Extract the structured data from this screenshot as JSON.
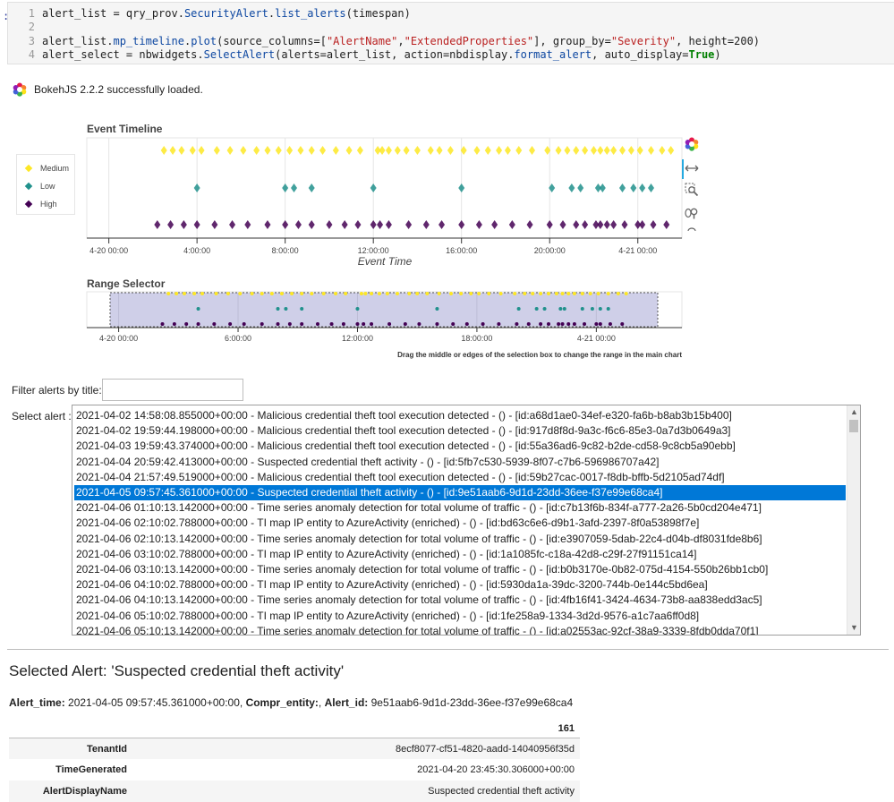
{
  "code_cell": {
    "prompt": ":",
    "lines": [
      {
        "num": "1",
        "segments": [
          {
            "t": "alert_list = qry_prov.",
            "c": "v"
          },
          {
            "t": "SecurityAlert",
            "c": "a"
          },
          {
            "t": ".",
            "c": "v"
          },
          {
            "t": "list_alerts",
            "c": "a"
          },
          {
            "t": "(timespan)",
            "c": "v"
          }
        ]
      },
      {
        "num": "2",
        "segments": []
      },
      {
        "num": "3",
        "segments": [
          {
            "t": "alert_list.",
            "c": "v"
          },
          {
            "t": "mp_timeline",
            "c": "a"
          },
          {
            "t": ".",
            "c": "v"
          },
          {
            "t": "plot",
            "c": "a"
          },
          {
            "t": "(source_columns=[",
            "c": "v"
          },
          {
            "t": "\"AlertName\"",
            "c": "s"
          },
          {
            "t": ",",
            "c": "v"
          },
          {
            "t": "\"ExtendedProperties\"",
            "c": "s"
          },
          {
            "t": "], group_by=",
            "c": "v"
          },
          {
            "t": "\"Severity\"",
            "c": "s"
          },
          {
            "t": ", height=200)",
            "c": "v"
          }
        ]
      },
      {
        "num": "4",
        "segments": [
          {
            "t": "alert_select = nbwidgets.",
            "c": "v"
          },
          {
            "t": "SelectAlert",
            "c": "a"
          },
          {
            "t": "(alerts=alert_list, action=nbdisplay.",
            "c": "v"
          },
          {
            "t": "format_alert",
            "c": "a"
          },
          {
            "t": ", auto_display=",
            "c": "v"
          },
          {
            "t": "True",
            "c": "k"
          },
          {
            "t": ")",
            "c": "v"
          }
        ]
      }
    ]
  },
  "bokeh": {
    "loaded_message": "BokehJS 2.2.2 successfully loaded."
  },
  "timeline": {
    "title": "Event Timeline",
    "xlabel": "Event Time",
    "x_ticks": [
      "4-20 00:00",
      "4:00:00",
      "8:00:00",
      "12:00:00",
      "16:00:00",
      "20:00:00",
      "4-21 00:00"
    ],
    "legend": [
      {
        "label": "Medium",
        "color": "#fde725"
      },
      {
        "label": "Low",
        "color": "#21918c"
      },
      {
        "label": "High",
        "color": "#440154"
      }
    ],
    "toolbar_icons": [
      "bokeh-logo-icon",
      "pan-icon",
      "box-zoom-icon",
      "wheel-zoom-icon",
      "reset-icon"
    ]
  },
  "range_selector": {
    "title": "Range Selector",
    "x_ticks": [
      "4-20 00:00",
      "6:00:00",
      "12:00:00",
      "18:00:00",
      "4-21 00:00"
    ],
    "note": "Drag the middle or edges of the selection box to change the range in the main chart"
  },
  "chart_data": {
    "type": "scatter",
    "title": "Event Timeline",
    "xlabel": "Event Time",
    "x_unit": "hours from 4-20 00:00",
    "xlim": [
      -1,
      26
    ],
    "series": [
      {
        "name": "Medium",
        "color": "#fde725",
        "x": [
          2.5,
          2.9,
          3.3,
          3.8,
          4.2,
          4.9,
          5.5,
          6.1,
          6.7,
          7.2,
          7.7,
          8.2,
          8.7,
          9.2,
          9.7,
          10.3,
          10.9,
          11.4,
          12.2,
          12.4,
          12.7,
          13.1,
          13.5,
          14.0,
          14.6,
          15.0,
          15.5,
          16.1,
          16.7,
          17.2,
          17.7,
          18.1,
          18.6,
          19.2,
          19.9,
          20.4,
          20.8,
          21.2,
          21.6,
          22.0,
          22.3,
          22.6,
          22.9,
          23.3,
          23.7,
          24.1,
          24.6,
          25.1,
          25.5
        ]
      },
      {
        "name": "Low",
        "color": "#21918c",
        "x": [
          4.0,
          8.0,
          8.4,
          9.2,
          12.0,
          16.0,
          20.1,
          21.0,
          21.4,
          22.2,
          22.4,
          23.3,
          23.8,
          24.2,
          24.6
        ]
      },
      {
        "name": "High",
        "color": "#440154",
        "x": [
          2.2,
          2.8,
          3.4,
          4.0,
          4.8,
          5.6,
          6.3,
          7.2,
          8.0,
          8.6,
          9.2,
          10.0,
          10.7,
          11.3,
          12.0,
          12.3,
          12.7,
          13.6,
          14.4,
          15.1,
          16.0,
          16.8,
          17.5,
          18.3,
          19.1,
          20.0,
          20.6,
          21.2,
          21.6,
          22.1,
          22.3,
          22.6,
          22.9,
          23.4,
          24.0,
          24.2,
          24.7,
          25.3
        ]
      }
    ]
  },
  "filter": {
    "label": "Filter alerts by title:",
    "value": ""
  },
  "select": {
    "label": "Select alert :",
    "selected_index": 5,
    "options": [
      "2021-04-02 14:58:08.855000+00:00 - Malicious credential theft tool execution detected - () - [id:a68d1ae0-34ef-e320-fa6b-b8ab3b15b400]",
      "2021-04-02 19:59:44.198000+00:00 - Malicious credential theft tool execution detected - () - [id:917d8f8d-9a3c-f6c6-85e3-0a7d3b0649a3]",
      "2021-04-03 19:59:43.374000+00:00 - Malicious credential theft tool execution detected - () - [id:55a36ad6-9c82-b2de-cd58-9c8cb5a90ebb]",
      "2021-04-04 20:59:42.413000+00:00 - Suspected credential theft activity - () - [id:5fb7c530-5939-8f07-c7b6-596986707a42]",
      "2021-04-04 21:57:49.519000+00:00 - Malicious credential theft tool execution detected - () - [id:59b27cac-0017-f8db-bffb-5d2105ad74df]",
      "2021-04-05 09:57:45.361000+00:00 - Suspected credential theft activity - () - [id:9e51aab6-9d1d-23dd-36ee-f37e99e68ca4]",
      "2021-04-06 01:10:13.142000+00:00 - Time series anomaly detection for total volume of traffic - () - [id:c7b13f6b-834f-a777-2a26-5b0cd204e471]",
      "2021-04-06 02:10:02.788000+00:00 - TI map IP entity to AzureActivity (enriched) - () - [id:bd63c6e6-d9b1-3afd-2397-8f0a53898f7e]",
      "2021-04-06 02:10:13.142000+00:00 - Time series anomaly detection for total volume of traffic - () - [id:e3907059-5dab-22c4-d04b-df8031fde8b6]",
      "2021-04-06 03:10:02.788000+00:00 - TI map IP entity to AzureActivity (enriched) - () - [id:1a1085fc-c18a-42d8-c29f-27f91151ca14]",
      "2021-04-06 03:10:13.142000+00:00 - Time series anomaly detection for total volume of traffic - () - [id:b0b3170e-0b82-075d-4154-550b26bb1cb0]",
      "2021-04-06 04:10:02.788000+00:00 - TI map IP entity to AzureActivity (enriched) - () - [id:5930da1a-39dc-3200-744b-0e144c5bd6ea]",
      "2021-04-06 04:10:13.142000+00:00 - Time series anomaly detection for total volume of traffic - () - [id:4fb16f41-3424-4634-73b8-aa838edd3ac5]",
      "2021-04-06 05:10:02.788000+00:00 - TI map IP entity to AzureActivity (enriched) - () - [id:1fe258a9-1334-3d2d-9576-a1c7aa6ff0d8]",
      "2021-04-06 05:10:13.142000+00:00 - Time series anomaly detection for total volume of traffic - () - [id:a02553ac-92cf-38a9-3339-8fdb0dda70f1]"
    ]
  },
  "selected_alert": {
    "heading": "Selected Alert: 'Suspected credential theft activity'",
    "alert_time_label": "Alert_time:",
    "alert_time": "2021-04-05 09:57:45.361000+00:00,",
    "compr_entity_label": "Compr_entity:",
    "compr_entity": ",",
    "alert_id_label": "Alert_id:",
    "alert_id": "9e51aab6-9d1d-23dd-36ee-f37e99e68ca4",
    "table_header": "161",
    "rows": [
      {
        "key": "TenantId",
        "value": "8ecf8077-cf51-4820-aadd-14040956f35d"
      },
      {
        "key": "TimeGenerated",
        "value": "2021-04-20 23:45:30.306000+00:00"
      },
      {
        "key": "AlertDisplayName",
        "value": "Suspected credential theft activity"
      }
    ]
  }
}
